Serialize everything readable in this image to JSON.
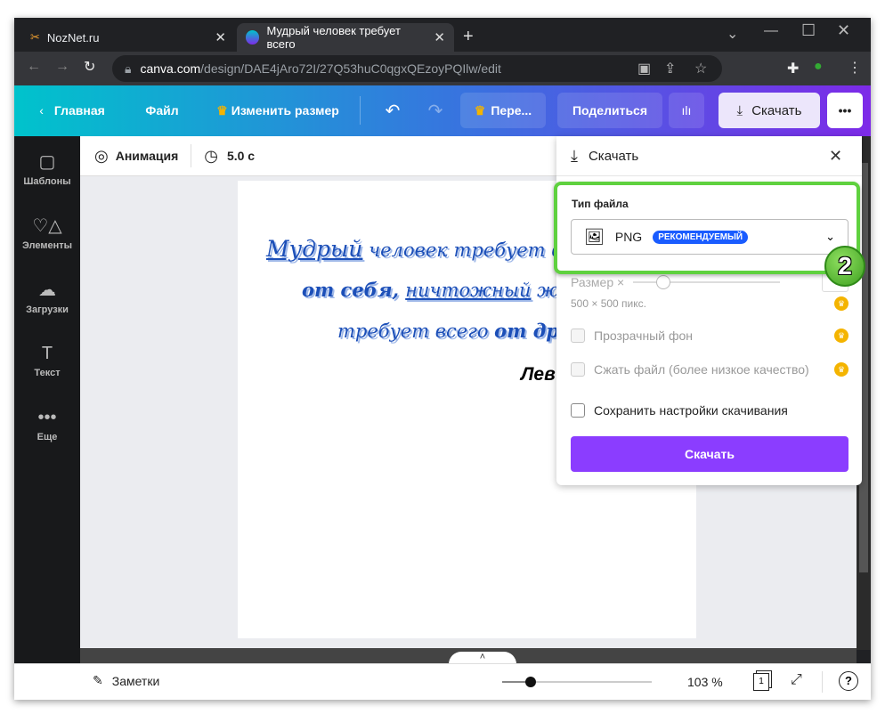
{
  "browser": {
    "tabs": [
      {
        "title": "NozNet.ru"
      },
      {
        "title": "Мудрый человек требует всего"
      }
    ],
    "url_host": "canva.com",
    "url_path": "/design/DAE4jAro72I/27Q53huC0qgxQEzoyPQIlw/edit"
  },
  "header": {
    "home": "Главная",
    "file": "Файл",
    "resize": "Изменить размер",
    "transfer": "Пере...",
    "share": "Поделиться",
    "download": "Скачать",
    "more": "•••"
  },
  "sidebar": {
    "items": [
      {
        "label": "Шаблоны",
        "icon": "▢"
      },
      {
        "label": "Элементы",
        "icon": "♡△"
      },
      {
        "label": "Загрузки",
        "icon": "☁"
      },
      {
        "label": "Текст",
        "icon": "T"
      },
      {
        "label": "Еще",
        "icon": "•••"
      }
    ]
  },
  "toolbar": {
    "animation": "Анимация",
    "duration": "5.0 с"
  },
  "design": {
    "line1a": "Мудрый",
    "line1b": " человек требует вс",
    "line2a": "от себя, ",
    "line2b": "ничтожный",
    "line2c": " же",
    "line3a": "требует всего ",
    "line3b": "от дру",
    "author": "Лев"
  },
  "panel": {
    "title": "Скачать",
    "file_type_label": "Тип файла",
    "file_type": "PNG",
    "badge": "РЕКОМЕНДУЕМЫЙ",
    "size_label": "Размер ×",
    "dims": "500 × 500 пикс.",
    "transparent": "Прозрачный фон",
    "compress": "Сжать файл (более низкое качество)",
    "save_settings": "Сохранить настройки скачивания",
    "download_button": "Скачать",
    "step_badge": "2"
  },
  "bottom": {
    "notes": "Заметки",
    "zoom": "103 %",
    "page_num": "1",
    "help": "?"
  },
  "colors": {
    "accent": "#8b3dff",
    "highlight": "#5fd13f",
    "badge": "#1a5cff"
  }
}
